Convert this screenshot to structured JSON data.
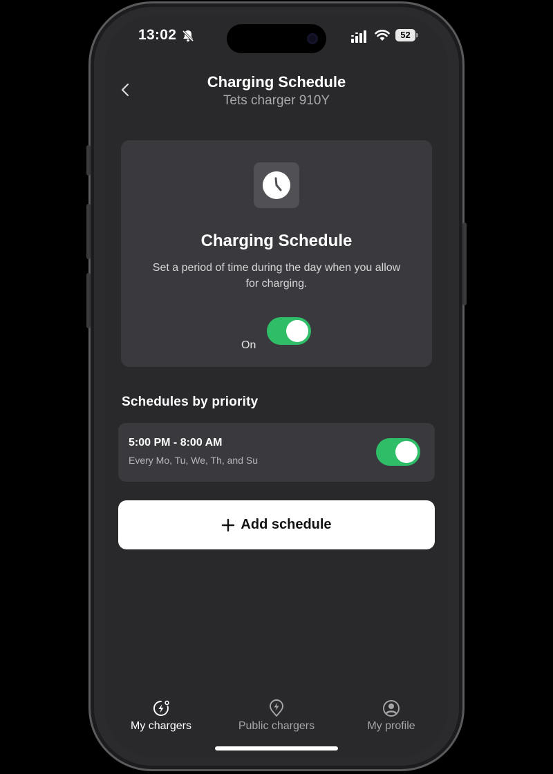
{
  "status_bar": {
    "time": "13:02",
    "battery": "52"
  },
  "header": {
    "title": "Charging Schedule",
    "subtitle": "Tets charger 910Y"
  },
  "card": {
    "title": "Charging Schedule",
    "description": "Set a period of time during the day when you allow for charging.",
    "toggle_label": "On",
    "toggle_on": true
  },
  "schedules": {
    "section_title": "Schedules by priority",
    "items": [
      {
        "time_range": "5:00 PM - 8:00 AM",
        "days": "Every Mo, Tu, We, Th, and Su",
        "enabled": true
      }
    ]
  },
  "add_button": {
    "label": "Add schedule"
  },
  "tabs": [
    {
      "label": "My chargers",
      "icon": "charger-icon",
      "active": true
    },
    {
      "label": "Public chargers",
      "icon": "bolt-pin-icon",
      "active": false
    },
    {
      "label": "My profile",
      "icon": "profile-icon",
      "active": false
    }
  ],
  "colors": {
    "background": "#29292c",
    "card": "#3a3a3e",
    "toggle_on": "#2fbd67",
    "button": "#ffffff"
  }
}
